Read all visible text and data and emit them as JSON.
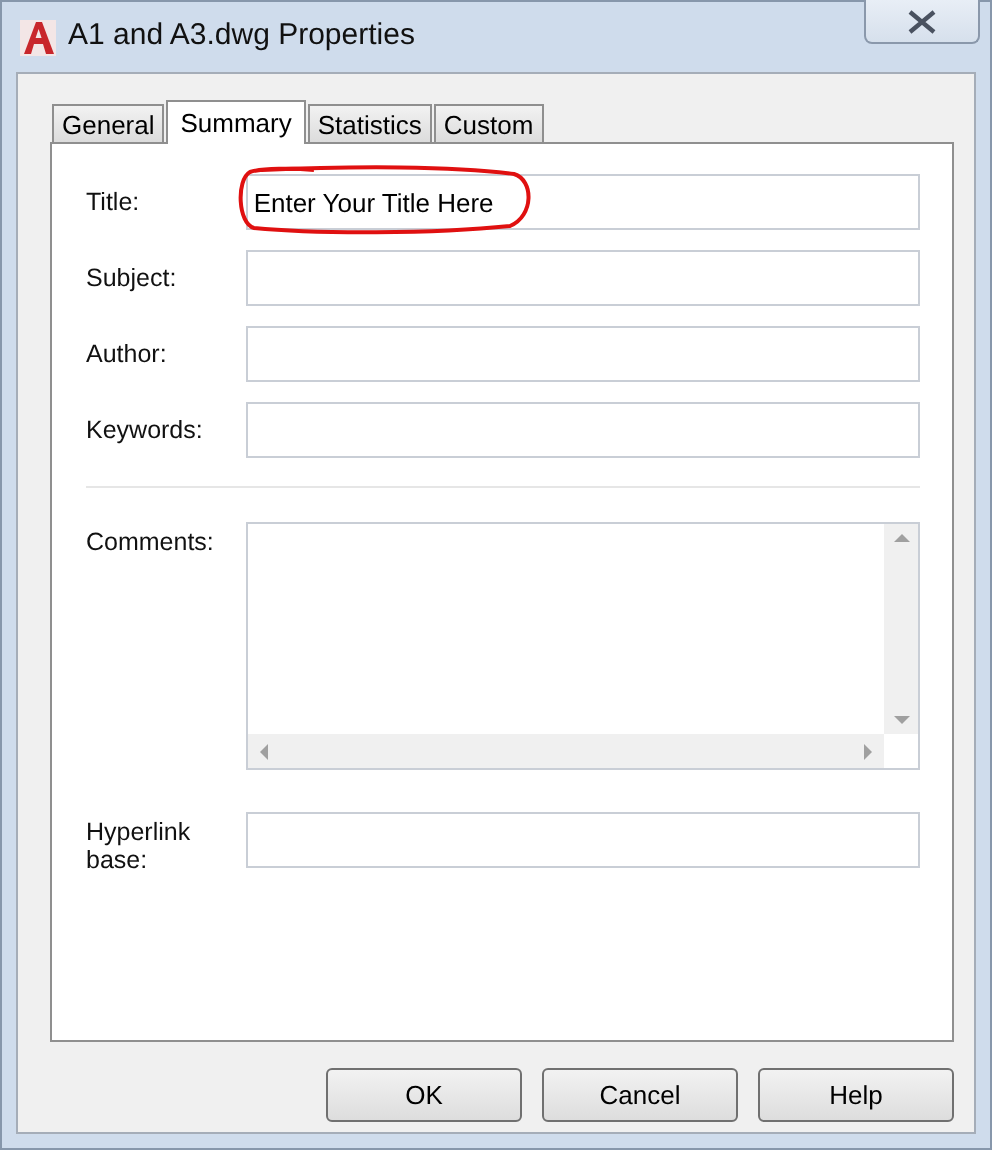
{
  "window": {
    "title": "A1 and A3.dwg Properties"
  },
  "tabs": [
    {
      "label": "General",
      "selected": false
    },
    {
      "label": "Summary",
      "selected": true
    },
    {
      "label": "Statistics",
      "selected": false
    },
    {
      "label": "Custom",
      "selected": false
    }
  ],
  "fields": [
    {
      "label": "Title:",
      "kind": "text",
      "value": "Enter Your Title Here",
      "highlighted": true
    },
    {
      "label": "Subject:",
      "kind": "text",
      "highlighted": false
    },
    {
      "label": "Author:",
      "kind": "text",
      "highlighted": false
    },
    {
      "label": "Keywords:",
      "kind": "text",
      "highlighted": false
    },
    {
      "label": "Comments:",
      "kind": "multiline",
      "highlighted": false
    },
    {
      "label": "Hyperlink base:",
      "kind": "text",
      "highlighted": false
    }
  ],
  "buttons": [
    "OK",
    "Cancel",
    "Help"
  ]
}
